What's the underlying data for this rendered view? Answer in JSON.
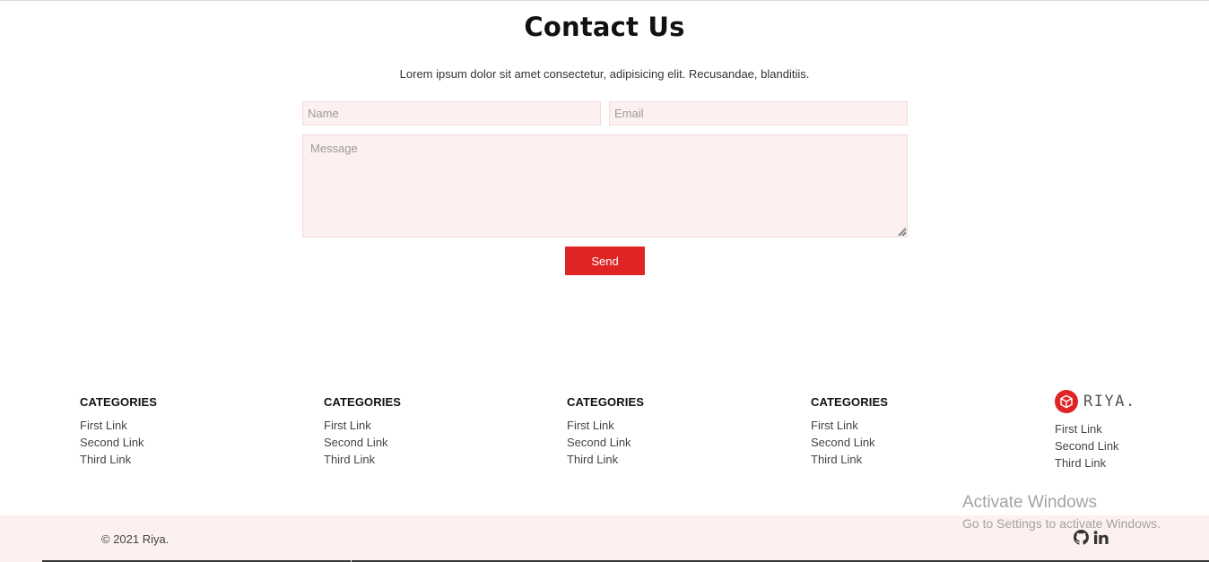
{
  "contact": {
    "title": "Contact Us",
    "subtitle": "Lorem ipsum dolor sit amet consectetur, adipisicing elit. Recusandae, blanditiis.",
    "name_placeholder": "Name",
    "email_placeholder": "Email",
    "message_placeholder": "Message",
    "send_label": "Send"
  },
  "footer": {
    "columns": [
      {
        "heading": "CATEGORIES",
        "links": [
          "First Link",
          "Second Link",
          "Third Link"
        ]
      },
      {
        "heading": "CATEGORIES",
        "links": [
          "First Link",
          "Second Link",
          "Third Link"
        ]
      },
      {
        "heading": "CATEGORIES",
        "links": [
          "First Link",
          "Second Link",
          "Third Link"
        ]
      },
      {
        "heading": "CATEGORIES",
        "links": [
          "First Link",
          "Second Link",
          "Third Link"
        ]
      }
    ],
    "brand": {
      "name": "RIYA.",
      "icon": "cube-icon",
      "links": [
        "First Link",
        "Second Link",
        "Third Link"
      ]
    }
  },
  "bottom_bar": {
    "copyright": "© 2021 Riya.",
    "social_icons": [
      "github-icon",
      "linkedin-icon"
    ]
  },
  "watermark": {
    "line1": "Activate Windows",
    "line2": "Go to Settings to activate Windows."
  },
  "colors": {
    "accent": "#e02424",
    "field_background": "#fdf0f0",
    "footer_background": "#fdf0f0"
  }
}
